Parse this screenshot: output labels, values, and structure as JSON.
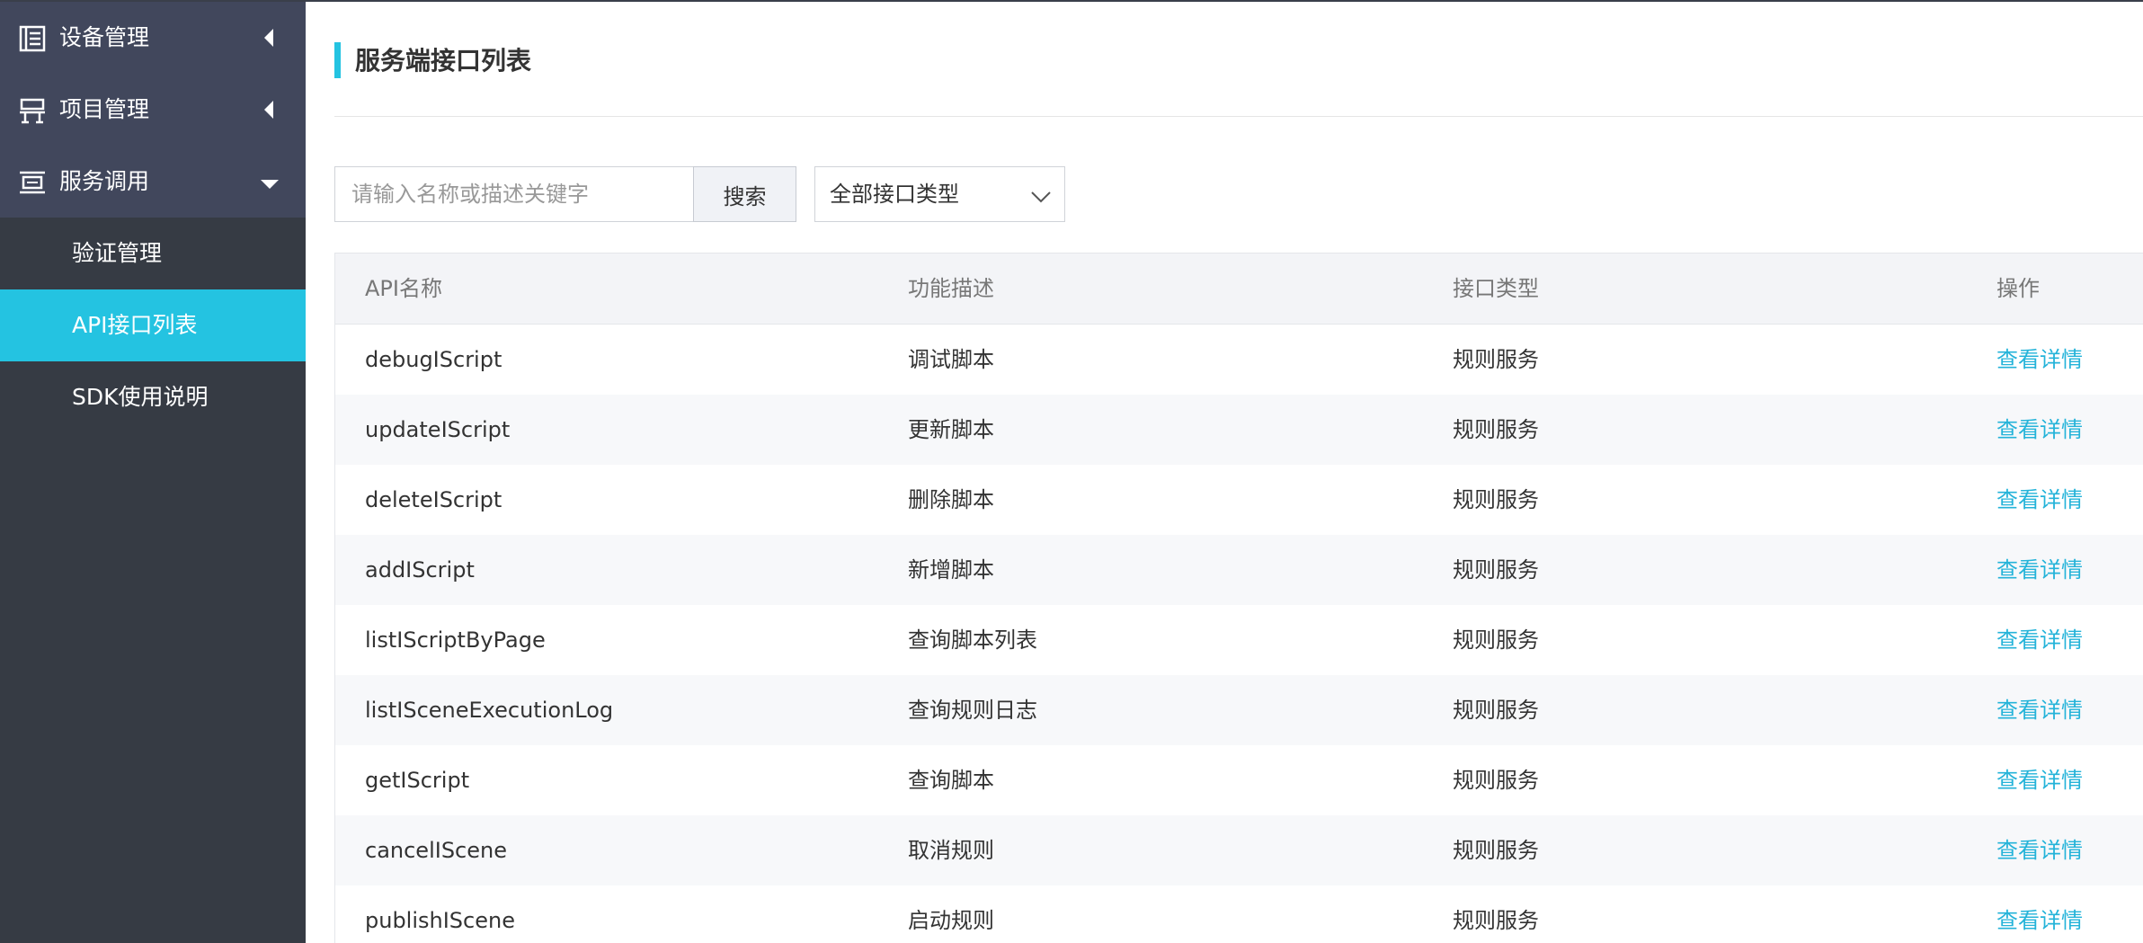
{
  "sidebar": {
    "menu": [
      {
        "label": "设备管理",
        "icon": "list-icon",
        "state": "collapsed"
      },
      {
        "label": "项目管理",
        "icon": "project-icon",
        "state": "collapsed"
      },
      {
        "label": "服务调用",
        "icon": "service-icon",
        "state": "expanded"
      }
    ],
    "sub_items": [
      {
        "label": "验证管理",
        "active": false
      },
      {
        "label": "API接口列表",
        "active": true
      },
      {
        "label": "SDK使用说明",
        "active": false
      }
    ]
  },
  "main": {
    "title": "服务端接口列表",
    "search": {
      "placeholder": "请输入名称或描述关键字",
      "value": "",
      "button_label": "搜索"
    },
    "type_select": {
      "value": "全部接口类型"
    },
    "table": {
      "headers": [
        "API名称",
        "功能描述",
        "接口类型",
        "操作"
      ],
      "rows": [
        {
          "name": "debugIScript",
          "desc": "调试脚本",
          "type": "规则服务",
          "action": "查看详情"
        },
        {
          "name": "updateIScript",
          "desc": "更新脚本",
          "type": "规则服务",
          "action": "查看详情"
        },
        {
          "name": "deleteIScript",
          "desc": "删除脚本",
          "type": "规则服务",
          "action": "查看详情"
        },
        {
          "name": "addIScript",
          "desc": "新增脚本",
          "type": "规则服务",
          "action": "查看详情"
        },
        {
          "name": "listIScriptByPage",
          "desc": "查询脚本列表",
          "type": "规则服务",
          "action": "查看详情"
        },
        {
          "name": "listISceneExecutionLog",
          "desc": "查询规则日志",
          "type": "规则服务",
          "action": "查看详情"
        },
        {
          "name": "getIScript",
          "desc": "查询脚本",
          "type": "规则服务",
          "action": "查看详情"
        },
        {
          "name": "cancelIScene",
          "desc": "取消规则",
          "type": "规则服务",
          "action": "查看详情"
        },
        {
          "name": "publishIScene",
          "desc": "启动规则",
          "type": "规则服务",
          "action": "查看详情"
        }
      ]
    }
  },
  "colors": {
    "accent": "#24c3e1",
    "link": "#24b3d9",
    "sidebar_bg": "#363b44",
    "menu_bg": "#41475c"
  }
}
